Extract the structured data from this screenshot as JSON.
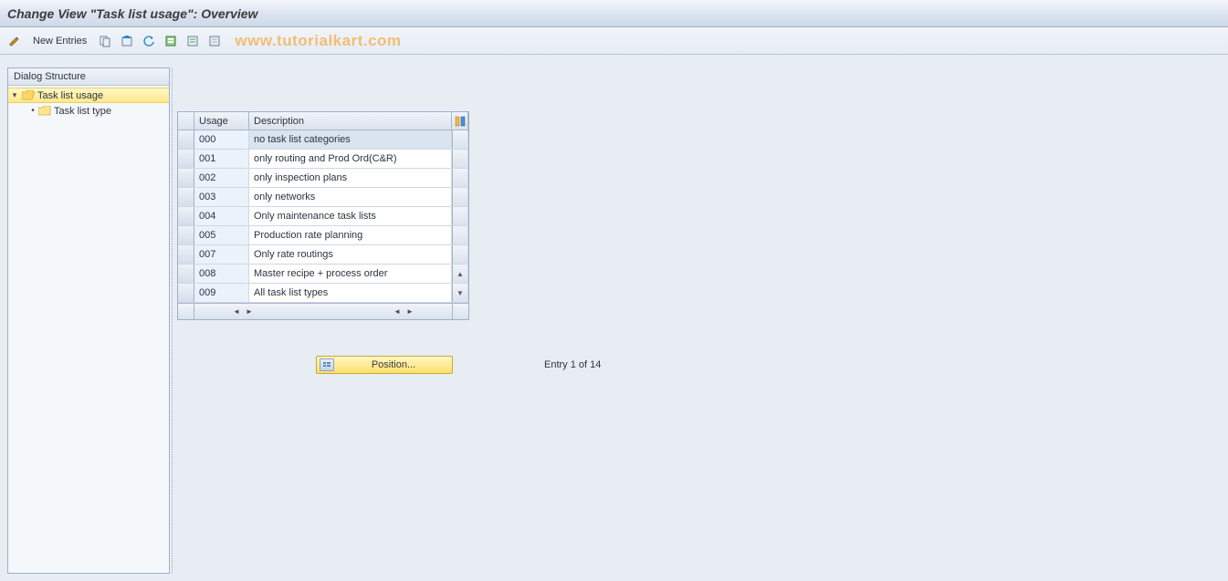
{
  "title": "Change View \"Task list usage\": Overview",
  "toolbar": {
    "new_entries_label": "New Entries"
  },
  "watermark": "www.tutorialkart.com",
  "dialog_structure": {
    "header": "Dialog Structure",
    "root": {
      "label": "Task list usage",
      "expanded": true,
      "selected": true
    },
    "child": {
      "label": "Task list type"
    }
  },
  "table": {
    "columns": {
      "usage": "Usage",
      "description": "Description"
    },
    "rows": [
      {
        "usage": "000",
        "description": "no task list categories",
        "highlight": true
      },
      {
        "usage": "001",
        "description": "only routing and Prod Ord(C&R)"
      },
      {
        "usage": "002",
        "description": "only inspection plans"
      },
      {
        "usage": "003",
        "description": "only networks"
      },
      {
        "usage": "004",
        "description": "Only maintenance task lists"
      },
      {
        "usage": "005",
        "description": "Production rate planning"
      },
      {
        "usage": "007",
        "description": "Only rate routings"
      },
      {
        "usage": "008",
        "description": "Master recipe + process order"
      },
      {
        "usage": "009",
        "description": "All task list types"
      }
    ]
  },
  "footer": {
    "position_label": "Position...",
    "entry_text": "Entry 1 of 14"
  }
}
